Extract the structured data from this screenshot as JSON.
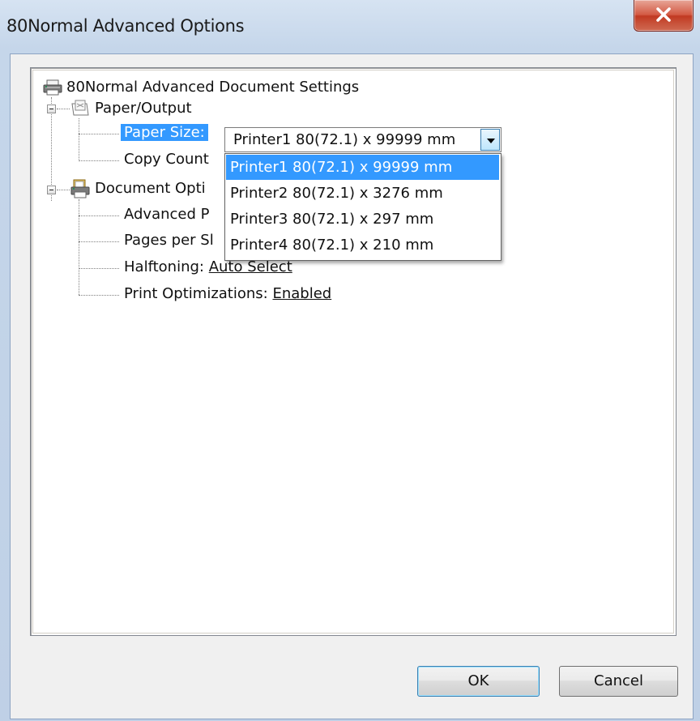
{
  "window": {
    "title": "80Normal Advanced Options"
  },
  "tree": {
    "root": {
      "label": "80Normal Advanced Document Settings"
    },
    "paper_output": {
      "label": "Paper/Output",
      "paper_size": {
        "label": "Paper Size:",
        "value": "Printer1 80(72.1) x 99999 mm"
      },
      "copy_count": {
        "label": "Copy Count"
      }
    },
    "document_options": {
      "label": "Document Opti",
      "advanced_printing": {
        "label": "Advanced P"
      },
      "pages_per_sheet": {
        "label": "Pages per Sl"
      },
      "halftoning": {
        "label": "Halftoning:",
        "value": "Auto Select"
      },
      "print_optimizations": {
        "label": "Print Optimizations:",
        "value": "Enabled"
      }
    }
  },
  "dropdown": {
    "options": [
      "Printer1 80(72.1) x 99999 mm",
      "Printer2 80(72.1) x 3276 mm",
      "Printer3 80(72.1) x 297 mm",
      "Printer4 80(72.1) x 210 mm"
    ],
    "selected_index": 0
  },
  "buttons": {
    "ok": "OK",
    "cancel": "Cancel"
  },
  "colors": {
    "selection": "#3399ff",
    "close_button": "#c13a22"
  },
  "icons": [
    "printer-icon",
    "paper-icon",
    "document-options-icon",
    "close-icon",
    "dropdown-arrow-icon"
  ]
}
